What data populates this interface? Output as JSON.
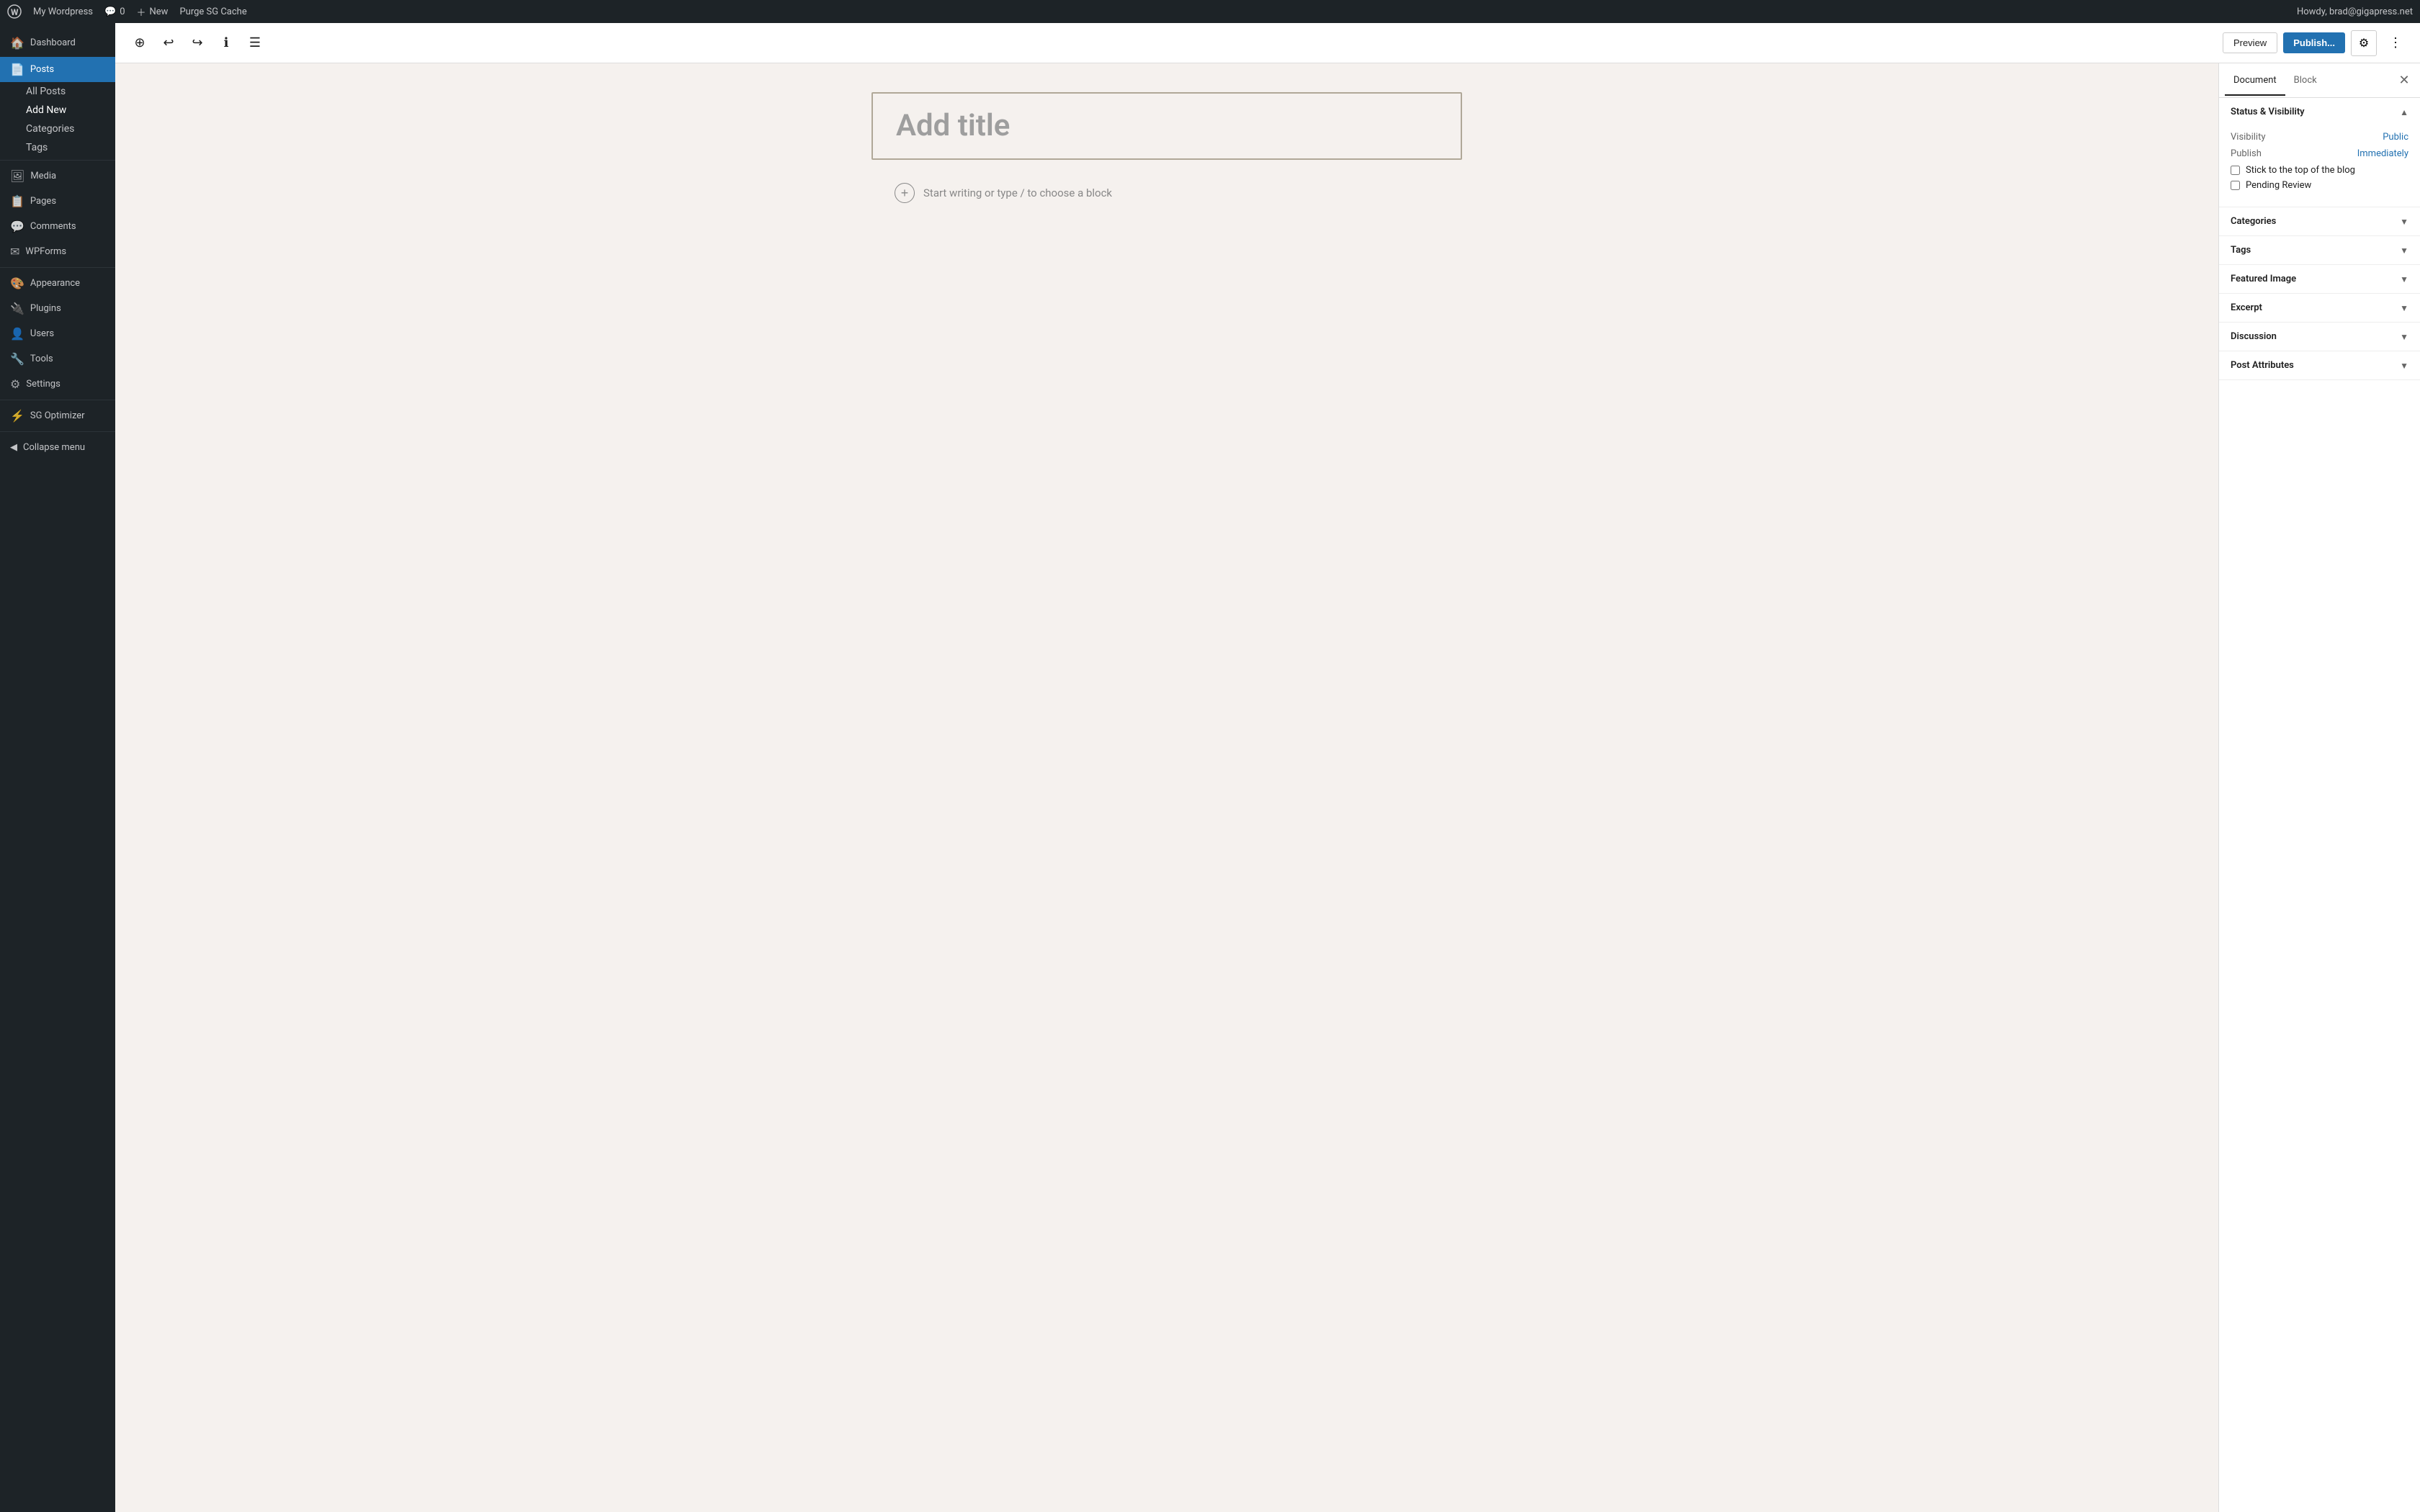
{
  "admin_bar": {
    "site_name": "My Wordpress",
    "comments_count": "0",
    "new_label": "New",
    "purge_label": "Purge SG Cache",
    "howdy_text": "Howdy, brad@gigapress.net"
  },
  "sidebar": {
    "dashboard_label": "Dashboard",
    "items": [
      {
        "id": "posts",
        "label": "Posts",
        "active": true,
        "icon": "📄"
      },
      {
        "id": "media",
        "label": "Media",
        "icon": "🖼"
      },
      {
        "id": "pages",
        "label": "Pages",
        "icon": "📋"
      },
      {
        "id": "comments",
        "label": "Comments",
        "icon": "💬"
      },
      {
        "id": "wpforms",
        "label": "WPForms",
        "icon": "✉"
      },
      {
        "id": "appearance",
        "label": "Appearance",
        "icon": "🎨"
      },
      {
        "id": "plugins",
        "label": "Plugins",
        "icon": "🔌"
      },
      {
        "id": "users",
        "label": "Users",
        "icon": "👤"
      },
      {
        "id": "tools",
        "label": "Tools",
        "icon": "🔧"
      },
      {
        "id": "settings",
        "label": "Settings",
        "icon": "⚙"
      },
      {
        "id": "sg-optimizer",
        "label": "SG Optimizer",
        "icon": "⚡"
      }
    ],
    "posts_sub": [
      {
        "label": "All Posts"
      },
      {
        "label": "Add New",
        "active": true
      },
      {
        "label": "Categories"
      },
      {
        "label": "Tags"
      }
    ],
    "collapse_label": "Collapse menu"
  },
  "toolbar": {
    "add_block_title": "Add block",
    "undo_title": "Undo",
    "redo_title": "Redo",
    "info_title": "Details",
    "list_view_title": "List View",
    "preview_label": "Preview",
    "publish_label": "Publish...",
    "settings_title": "Settings",
    "options_title": "Options"
  },
  "editor": {
    "title_placeholder": "Add title",
    "block_placeholder": "Start writing or type / to choose a block"
  },
  "panel": {
    "document_tab": "Document",
    "block_tab": "Block",
    "sections": {
      "status_visibility": {
        "label": "Status & Visibility",
        "expanded": true,
        "visibility_label": "Visibility",
        "visibility_value": "Public",
        "publish_label": "Publish",
        "publish_value": "Immediately",
        "stick_label": "Stick to the top of the blog",
        "pending_label": "Pending Review"
      },
      "categories": {
        "label": "Categories",
        "expanded": false
      },
      "tags": {
        "label": "Tags",
        "expanded": false
      },
      "featured_image": {
        "label": "Featured Image",
        "expanded": false
      },
      "excerpt": {
        "label": "Excerpt",
        "expanded": false
      },
      "discussion": {
        "label": "Discussion",
        "expanded": false
      },
      "post_attributes": {
        "label": "Post Attributes",
        "expanded": false
      }
    }
  },
  "colors": {
    "admin_bg": "#1d2327",
    "active_blue": "#2271b1",
    "link_blue": "#2271b1"
  }
}
